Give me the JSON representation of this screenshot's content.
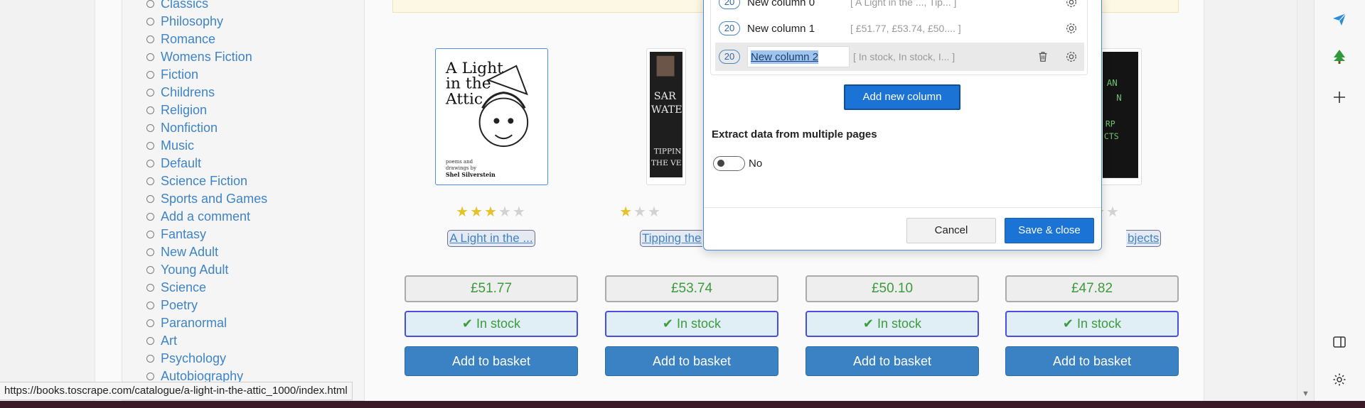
{
  "sidebar": {
    "categories": [
      "Classics",
      "Philosophy",
      "Romance",
      "Womens Fiction",
      "Fiction",
      "Childrens",
      "Religion",
      "Nonfiction",
      "Music",
      "Default",
      "Science Fiction",
      "Sports and Games",
      "Add a comment",
      "Fantasy",
      "New Adult",
      "Young Adult",
      "Science",
      "Poetry",
      "Paranormal",
      "Art",
      "Psychology",
      "Autobiography"
    ]
  },
  "products": [
    {
      "title": "A Light in the ...",
      "price": "£51.77",
      "stock": "In stock",
      "rating": 3,
      "basket": "Add to basket",
      "cover_text": [
        "A Light",
        "in the",
        "Attic"
      ],
      "cover_credit": [
        "poems and",
        "drawings by",
        "Shel Silverstein"
      ]
    },
    {
      "title": "Tipping the",
      "price": "£53.74",
      "stock": "In stock",
      "rating": 1,
      "basket": "Add to basket",
      "cover_text": [
        "SAR",
        "WATE",
        "TIPPIN",
        "THE VE"
      ]
    },
    {
      "title": "",
      "price": "£50.10",
      "stock": "In stock",
      "rating": 0,
      "basket": "Add to basket"
    },
    {
      "title": "bjects",
      "price": "£47.82",
      "stock": "In stock",
      "rating": 4,
      "basket": "Add to basket",
      "cover_text": [
        "AN",
        "N",
        "RP",
        "CTS"
      ]
    }
  ],
  "status_bar": {
    "url": "https://books.toscrape.com/catalogue/a-light-in-the-attic_1000/index.html"
  },
  "dialog": {
    "columns": [
      {
        "count": "20",
        "name": "New column 0",
        "preview": "[ A Light in the ...,  Tip... ]"
      },
      {
        "count": "20",
        "name": "New column 1",
        "preview": "[ £51.77,  £53.74,  £50.... ]"
      },
      {
        "count": "20",
        "name": "New column 2",
        "preview": "[ In stock,  In stock,  I... ]"
      }
    ],
    "add_column_label": "Add new column",
    "multi_pages_label": "Extract data from multiple pages",
    "toggle_value": "No",
    "cancel_label": "Cancel",
    "save_label": "Save & close"
  },
  "browser_rail": {
    "icons": [
      "send-icon",
      "tree-icon",
      "plus-icon",
      "split-view-icon",
      "settings-icon"
    ]
  },
  "colors": {
    "link": "#3f84c5",
    "price_green": "#3c9b3c",
    "primary_button": "#1b73d6",
    "basket_button": "#3a82c4",
    "star": "#e6c22a"
  }
}
